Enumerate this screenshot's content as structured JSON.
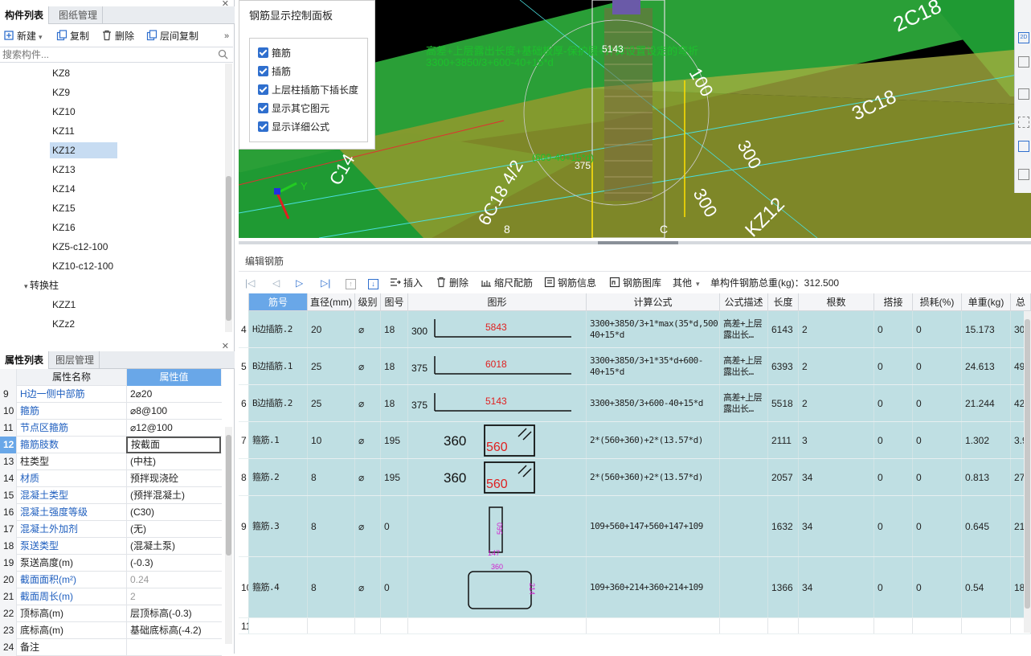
{
  "component_panel": {
    "tabs": [
      "构件列表",
      "图纸管理"
    ],
    "toolbar": {
      "new": "新建",
      "copy": "复制",
      "delete": "删除",
      "floor_copy": "层间复制",
      "more": "»"
    },
    "search_placeholder": "搜索构件...",
    "items": [
      "KZ8",
      "KZ9",
      "KZ10",
      "KZ11",
      "KZ12",
      "KZ13",
      "KZ14",
      "KZ15",
      "KZ16",
      "KZ5-c12-100",
      "KZ10-c12-100"
    ],
    "selected_item": "KZ12",
    "group": "转换柱",
    "group_items": [
      "KZZ1",
      "KZz2"
    ]
  },
  "property_panel": {
    "tabs": [
      "属性列表",
      "图层管理"
    ],
    "headers": {
      "name": "属性名称",
      "value": "属性值"
    },
    "rows": [
      {
        "num": "9",
        "name": "H边一侧中部筋",
        "value": "2⌀20",
        "blue": true
      },
      {
        "num": "10",
        "name": "箍筋",
        "value": "⌀8@100",
        "blue": true
      },
      {
        "num": "11",
        "name": "节点区箍筋",
        "value": "⌀12@100",
        "blue": true
      },
      {
        "num": "12",
        "name": "箍筋肢数",
        "value": "按截面",
        "blue": true,
        "selected": true
      },
      {
        "num": "13",
        "name": "柱类型",
        "value": "(中柱)"
      },
      {
        "num": "14",
        "name": "材质",
        "value": "预拌现浇砼",
        "blue": true
      },
      {
        "num": "15",
        "name": "混凝土类型",
        "value": "(预拌混凝土)",
        "blue": true
      },
      {
        "num": "16",
        "name": "混凝土强度等级",
        "value": "(C30)",
        "blue": true
      },
      {
        "num": "17",
        "name": "混凝土外加剂",
        "value": "(无)",
        "blue": true
      },
      {
        "num": "18",
        "name": "泵送类型",
        "value": "(混凝土泵)",
        "blue": true
      },
      {
        "num": "19",
        "name": "泵送高度(m)",
        "value": "(-0.3)"
      },
      {
        "num": "20",
        "name": "截面面积(m²)",
        "value": "0.24",
        "blue": true,
        "gray": true
      },
      {
        "num": "21",
        "name": "截面周长(m)",
        "value": "2",
        "blue": true,
        "gray": true
      },
      {
        "num": "22",
        "name": "顶标高(m)",
        "value": "层顶标高(-0.3)"
      },
      {
        "num": "23",
        "name": "底标高(m)",
        "value": "基础底标高(-4.2)"
      },
      {
        "num": "24",
        "name": "备注",
        "value": ""
      }
    ]
  },
  "control_panel": {
    "title": "钢筋显示控制面板",
    "options": [
      "箍筋",
      "插筋",
      "上层柱插筋下插长度",
      "显示其它图元",
      "显示详细公式"
    ]
  },
  "viewport": {
    "formula_line1": "高差+上层露出长度+基础板厚-保护层+计算设置设定的弯折",
    "formula_line2": "3300+3850/3+600-40+15*d",
    "labels": [
      "2C18",
      "3C18",
      "100",
      "300",
      "300",
      "375",
      "5143",
      "(600-40+15*d)",
      "6C18 4/2",
      "C14",
      "KZ12",
      "8",
      "C"
    ],
    "axis_y": "Y"
  },
  "editor": {
    "title": "编辑钢筋",
    "toolbar": {
      "insert": "插入",
      "delete": "删除",
      "scale": "缩尺配筋",
      "info": "钢筋信息",
      "library": "钢筋图库",
      "other": "其他",
      "total_weight_label": "单构件钢筋总重(kg)：312.500"
    },
    "columns": [
      "筋号",
      "直径(mm)",
      "级别",
      "图号",
      "图形",
      "计算公式",
      "公式描述",
      "长度",
      "根数",
      "搭接",
      "损耗(%)",
      "单重(kg)",
      "总"
    ],
    "rows": [
      {
        "num": "4",
        "name": "H边插筋.2",
        "dia": "20",
        "grade": "⌀",
        "fig": "18",
        "shape": "hook",
        "shape_left": "300",
        "shape_mid": "5843",
        "formula": "3300+3850/3+1*max(35*d,500)+600-40+15*d",
        "desc": "高差+上层露出长…",
        "len": "6143",
        "count": "2",
        "lap": "0",
        "loss": "0",
        "unit": "15.173",
        "total": "30."
      },
      {
        "num": "5",
        "name": "B边插筋.1",
        "dia": "25",
        "grade": "⌀",
        "fig": "18",
        "shape": "hook",
        "shape_left": "375",
        "shape_mid": "6018",
        "formula": "3300+3850/3+1*35*d+600-40+15*d",
        "desc": "高差+上层露出长…",
        "len": "6393",
        "count": "2",
        "lap": "0",
        "loss": "0",
        "unit": "24.613",
        "total": "49."
      },
      {
        "num": "6",
        "name": "B边插筋.2",
        "dia": "25",
        "grade": "⌀",
        "fig": "18",
        "shape": "hook",
        "shape_left": "375",
        "shape_mid": "5143",
        "formula": "3300+3850/3+600-40+15*d",
        "desc": "高差+上层露出长…",
        "len": "5518",
        "count": "2",
        "lap": "0",
        "loss": "0",
        "unit": "21.244",
        "total": "42."
      },
      {
        "num": "7",
        "name": "箍筋.1",
        "dia": "10",
        "grade": "⌀",
        "fig": "195",
        "shape": "stirrup",
        "shape_left": "360",
        "shape_mid": "560",
        "formula": "2*(560+360)+2*(13.57*d)",
        "desc": "",
        "len": "2111",
        "count": "3",
        "lap": "0",
        "loss": "0",
        "unit": "1.302",
        "total": "3.9"
      },
      {
        "num": "8",
        "name": "箍筋.2",
        "dia": "8",
        "grade": "⌀",
        "fig": "195",
        "shape": "stirrup",
        "shape_left": "360",
        "shape_mid": "560",
        "formula": "2*(560+360)+2*(13.57*d)",
        "desc": "",
        "len": "2057",
        "count": "34",
        "lap": "0",
        "loss": "0",
        "unit": "0.813",
        "total": "27."
      },
      {
        "num": "9",
        "name": "箍筋.3",
        "dia": "8",
        "grade": "⌀",
        "fig": "0",
        "shape": "narrow",
        "shape_left": "147",
        "shape_mid": "560",
        "formula": "109+560+147+560+147+109",
        "desc": "",
        "len": "1632",
        "count": "34",
        "lap": "0",
        "loss": "0",
        "unit": "0.645",
        "total": "21."
      },
      {
        "num": "10",
        "name": "箍筋.4",
        "dia": "8",
        "grade": "⌀",
        "fig": "0",
        "shape": "wide",
        "shape_left": "360",
        "shape_mid": "214",
        "formula": "109+360+214+360+214+109",
        "desc": "",
        "len": "1366",
        "count": "34",
        "lap": "0",
        "loss": "0",
        "unit": "0.54",
        "total": "18."
      }
    ],
    "empty_row_num": "11"
  }
}
